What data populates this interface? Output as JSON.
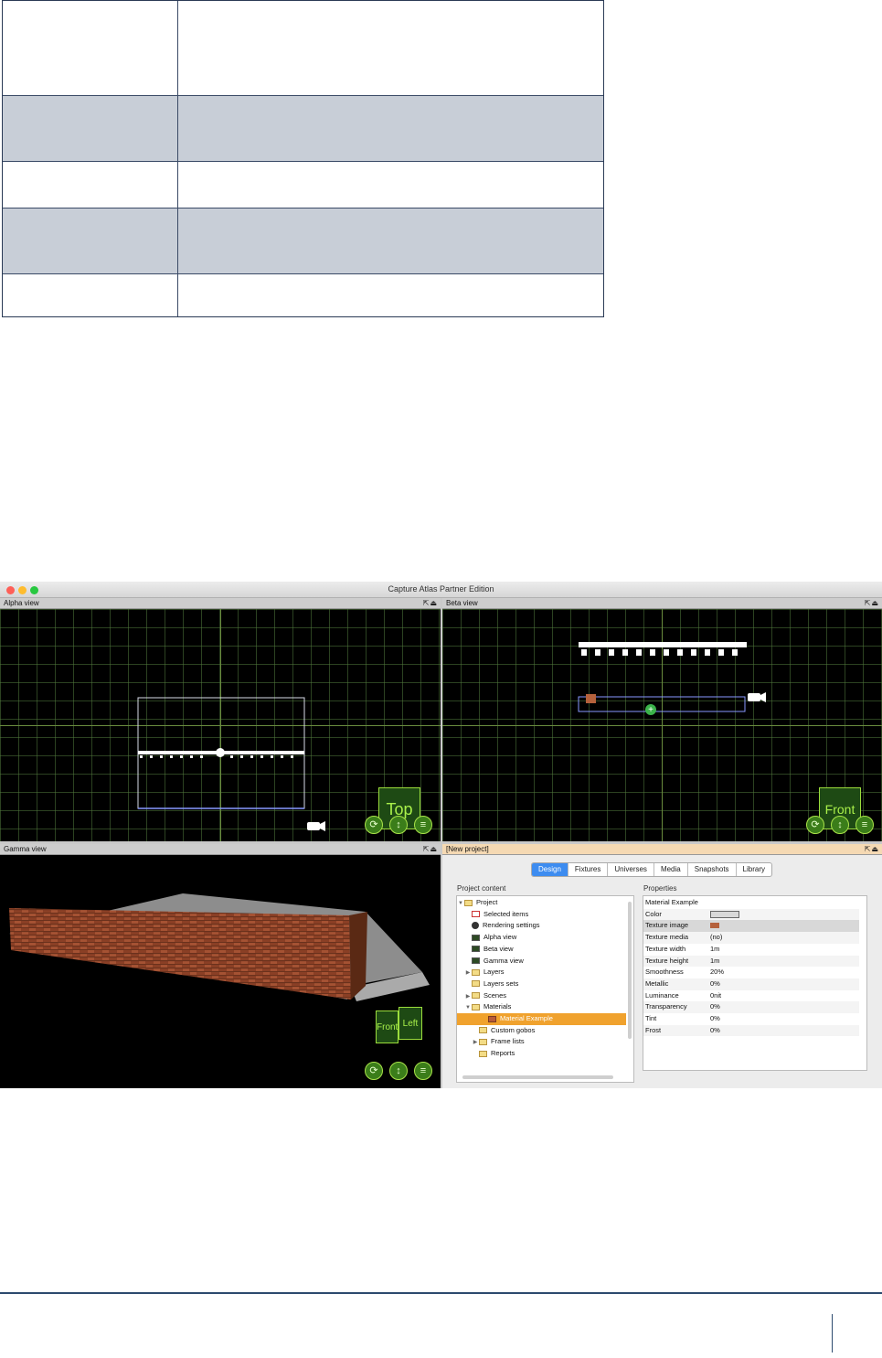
{
  "window": {
    "title": "Capture Atlas Partner Edition",
    "controls": {
      "close": "#fe5f57",
      "minimize": "#febc2e",
      "zoom": "#28c840"
    }
  },
  "views": {
    "alpha": {
      "title": "Alpha view",
      "cube": "Top"
    },
    "beta": {
      "title": "Beta view",
      "cube": "Front"
    },
    "gamma": {
      "title": "Gamma view",
      "cube_front": "Front",
      "cube_left": "Left"
    }
  },
  "project": {
    "title": "[New project]",
    "tabs": [
      {
        "label": "Design",
        "active": true
      },
      {
        "label": "Fixtures"
      },
      {
        "label": "Universes"
      },
      {
        "label": "Media"
      },
      {
        "label": "Snapshots"
      },
      {
        "label": "Library"
      }
    ],
    "content_label": "Project content",
    "properties_label": "Properties",
    "tree": [
      {
        "label": "Project",
        "indent": 0,
        "toggle": "▼",
        "icon": "folder"
      },
      {
        "label": "Selected items",
        "indent": 1,
        "icon": "sel"
      },
      {
        "label": "Rendering settings",
        "indent": 1,
        "icon": "render"
      },
      {
        "label": "Alpha view",
        "indent": 1,
        "icon": "img"
      },
      {
        "label": "Beta view",
        "indent": 1,
        "icon": "img"
      },
      {
        "label": "Gamma view",
        "indent": 1,
        "icon": "img"
      },
      {
        "label": "Layers",
        "indent": 1,
        "toggle": "▶",
        "icon": "folder"
      },
      {
        "label": "Layers sets",
        "indent": 1,
        "icon": "folder"
      },
      {
        "label": "Scenes",
        "indent": 1,
        "toggle": "▶",
        "icon": "folder"
      },
      {
        "label": "Materials",
        "indent": 1,
        "toggle": "▼",
        "icon": "folder"
      },
      {
        "label": "Material Example",
        "indent": 2,
        "icon": "mat",
        "selected": true
      },
      {
        "label": "Custom gobos",
        "indent": 1,
        "icon": "folder"
      },
      {
        "label": "Frame lists",
        "indent": 1,
        "toggle": "▶",
        "icon": "folder"
      },
      {
        "label": "Reports",
        "indent": 1,
        "icon": "folder"
      }
    ],
    "properties": {
      "header": "Material Example",
      "rows": [
        {
          "key": "Color",
          "value": "",
          "swatch": "color"
        },
        {
          "key": "Texture image",
          "value": "",
          "swatch": "texture",
          "highlight": true
        },
        {
          "key": "Texture media",
          "value": "(no)"
        },
        {
          "key": "Texture width",
          "value": "1m"
        },
        {
          "key": "Texture height",
          "value": "1m"
        },
        {
          "key": "Smoothness",
          "value": "20%"
        },
        {
          "key": "Metallic",
          "value": "0%"
        },
        {
          "key": "Luminance",
          "value": "0nit"
        },
        {
          "key": "Transparency",
          "value": "0%"
        },
        {
          "key": "Tint",
          "value": "0%"
        },
        {
          "key": "Frost",
          "value": "0%"
        }
      ]
    }
  },
  "icons": {
    "pane_header": "⇱⏏",
    "ctrl_rotate": "⟳",
    "ctrl_move": "↕",
    "ctrl_menu": "≡"
  }
}
